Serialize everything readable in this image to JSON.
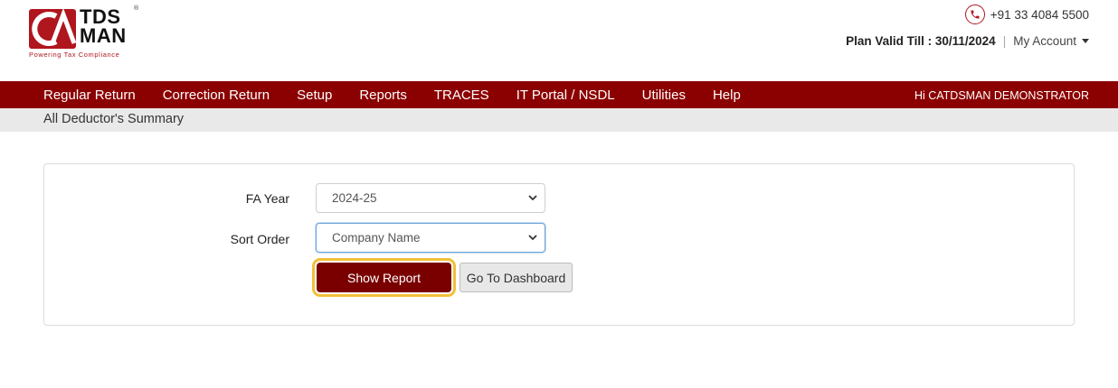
{
  "header": {
    "logo_word_line1": "TDS",
    "logo_word_line2": "MAN",
    "logo_tagline": "Powering Tax Compliance",
    "logo_registered": "®",
    "phone": "+91 33 4084 5500",
    "plan_label": "Plan Valid Till : 30/11/2024",
    "separator": "|",
    "my_account": "My Account"
  },
  "nav": {
    "items": [
      {
        "label": "Regular Return"
      },
      {
        "label": "Correction Return"
      },
      {
        "label": "Setup"
      },
      {
        "label": "Reports"
      },
      {
        "label": "TRACES"
      },
      {
        "label": "IT Portal / NSDL"
      },
      {
        "label": "Utilities"
      },
      {
        "label": "Help"
      }
    ],
    "user_greeting": "Hi CATDSMAN DEMONSTRATOR"
  },
  "breadcrumb": {
    "title": "All Deductor's Summary"
  },
  "form": {
    "fa_year_label": "FA Year",
    "fa_year_value": "2024-25",
    "sort_order_label": "Sort Order",
    "sort_order_value": "Company Name",
    "show_report_label": "Show Report",
    "dashboard_label": "Go To Dashboard"
  },
  "colors": {
    "brand": "#8b0000",
    "button_primary": "#7a0000",
    "highlight": "#f2c037"
  }
}
